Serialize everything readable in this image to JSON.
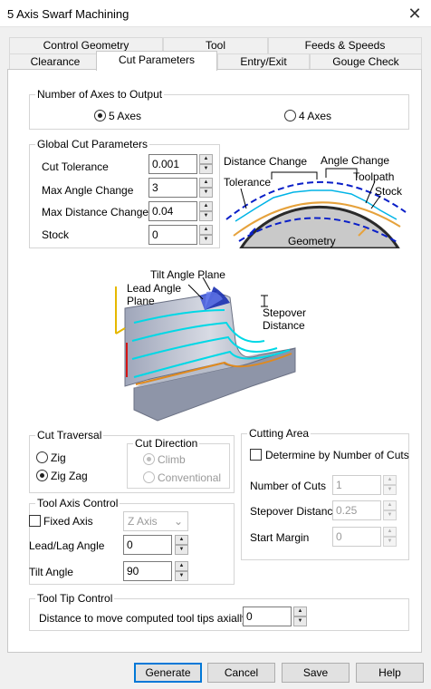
{
  "window": {
    "title": "5 Axis Swarf Machining",
    "close_glyph": "✕"
  },
  "tabs": {
    "row_back": [
      "Control Geometry",
      "Tool",
      "Feeds & Speeds"
    ],
    "row_front": [
      "Clearance",
      "Cut Parameters",
      "Entry/Exit",
      "Gouge Check"
    ],
    "active": "Cut Parameters"
  },
  "axes_output": {
    "title": "Number of Axes to Output",
    "options": [
      "5 Axes",
      "4 Axes"
    ],
    "selected": "5 Axes"
  },
  "global_cut": {
    "title": "Global Cut Parameters",
    "fields": [
      {
        "label": "Cut Tolerance",
        "value": "0.001"
      },
      {
        "label": "Max Angle Change",
        "value": "3"
      },
      {
        "label": "Max Distance Change",
        "value": "0.04"
      },
      {
        "label": "Stock",
        "value": "0"
      }
    ]
  },
  "toolpath_diagram": {
    "labels": {
      "distance_change": "Distance Change",
      "angle_change": "Angle Change",
      "tolerance": "Tolerance",
      "toolpath": "Toolpath",
      "stock": "Stock",
      "geometry": "Geometry"
    },
    "colors": {
      "toolpath": "#00b4e6",
      "stock": "#e6a23c",
      "tolerance": "#0a1fc8",
      "geometry": "#c9c9c9"
    }
  },
  "swarf_diagram": {
    "labels": {
      "tilt_angle_plane": "Tilt Angle Plane",
      "lead_angle_plane_1": "Lead Angle",
      "lead_angle_plane_2": "Plane",
      "stepover_1": "Stepover",
      "stepover_2": "Distance"
    }
  },
  "cut_traversal": {
    "title": "Cut Traversal",
    "options": [
      "Zig",
      "Zig Zag"
    ],
    "selected": "Zig Zag",
    "direction": {
      "title": "Cut Direction",
      "options": [
        "Climb",
        "Conventional"
      ],
      "selected": "Climb",
      "enabled": false
    }
  },
  "cutting_area": {
    "title": "Cutting Area",
    "determine_label": "Determine by Number of Cuts",
    "determine_checked": false,
    "fields": [
      {
        "label": "Number of Cuts",
        "value": "1"
      },
      {
        "label": "Stepover Distance",
        "value": "0.25"
      },
      {
        "label": "Start Margin",
        "value": "0"
      }
    ]
  },
  "tool_axis": {
    "title": "Tool Axis Control",
    "fixed_axis_label": "Fixed Axis",
    "fixed_axis_checked": false,
    "axis_select": "Z Axis",
    "lead_lag_label": "Lead/Lag Angle",
    "lead_lag_value": "0",
    "tilt_label": "Tilt Angle",
    "tilt_value": "90"
  },
  "tool_tip": {
    "title": "Tool Tip Control",
    "label": "Distance to move computed tool tips axially by",
    "value": "0"
  },
  "buttons": {
    "generate": "Generate",
    "cancel": "Cancel",
    "save": "Save",
    "help": "Help"
  }
}
